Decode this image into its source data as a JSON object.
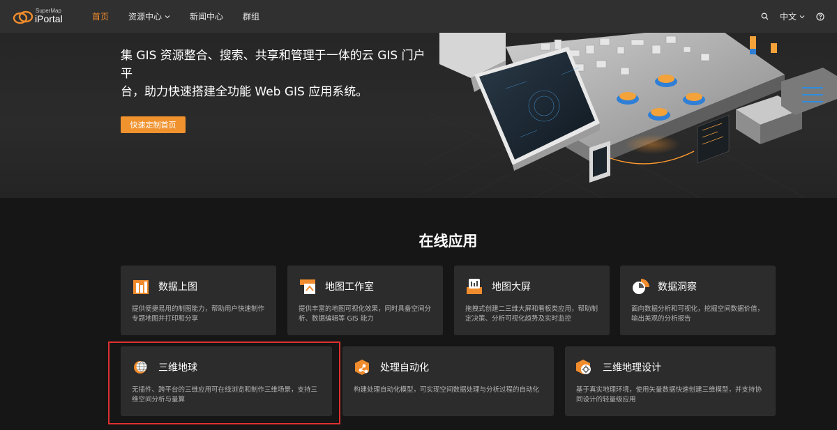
{
  "header": {
    "logo_small": "SuperMap",
    "logo_big": "iPortal",
    "nav": [
      {
        "label": "首页",
        "active": true
      },
      {
        "label": "资源中心",
        "has_dropdown": true
      },
      {
        "label": "新闻中心"
      },
      {
        "label": "群组"
      }
    ],
    "language": "中文",
    "icons": [
      "search-icon",
      "chevron-down-icon",
      "help-icon"
    ]
  },
  "hero": {
    "title_line1": "集 GIS 资源整合、搜索、共享和管理于一体的云 GIS 门户平",
    "title_line2": "台，助力快速搭建全功能 Web GIS 应用系统。",
    "button_label": "快速定制首页"
  },
  "section": {
    "title": "在线应用",
    "cards": [
      {
        "title": "数据上图",
        "desc1": "提供便捷易用的制图能力，帮助用户快速制作",
        "desc2": "专题地图并打印和分享",
        "icon": "chart-bars-icon"
      },
      {
        "title": "地图工作室",
        "desc1": "提供丰富的地图可视化效果，同时具备空间分",
        "desc2": "析、数据编辑等 GIS 能力",
        "icon": "map-studio-icon"
      },
      {
        "title": "地图大屏",
        "desc1": "拖拽式创建二三维大屏和看板类应用，帮助制",
        "desc2": "定决策、分析可视化趋势及实时监控",
        "icon": "dashboard-screen-icon"
      },
      {
        "title": "数据洞察",
        "desc1": "面向数据分析和可视化，挖掘空间数据价值，",
        "desc2": "输出美观的分析报告",
        "icon": "pie-insight-icon"
      },
      {
        "title": "三维地球",
        "desc1": "无插件、跨平台的三维应用可在线浏览和制作三维场景，支持三",
        "desc2": "维空间分析与量算",
        "icon": "globe-icon"
      },
      {
        "title": "处理自动化",
        "desc1": "构建处理自动化模型，可实现空间数据处理与分析过程的自动化",
        "desc2": "",
        "icon": "automation-icon"
      },
      {
        "title": "三维地理设计",
        "desc1": "基于真实地理环境，使用矢量数据快速创建三维模型，并支持协",
        "desc2": "同设计的轻量级应用",
        "icon": "geo-design-icon"
      }
    ]
  },
  "colors": {
    "accent": "#f08c2d",
    "header_bg": "#303030",
    "card_bg": "#2c2c2c",
    "highlight": "#e03030"
  }
}
